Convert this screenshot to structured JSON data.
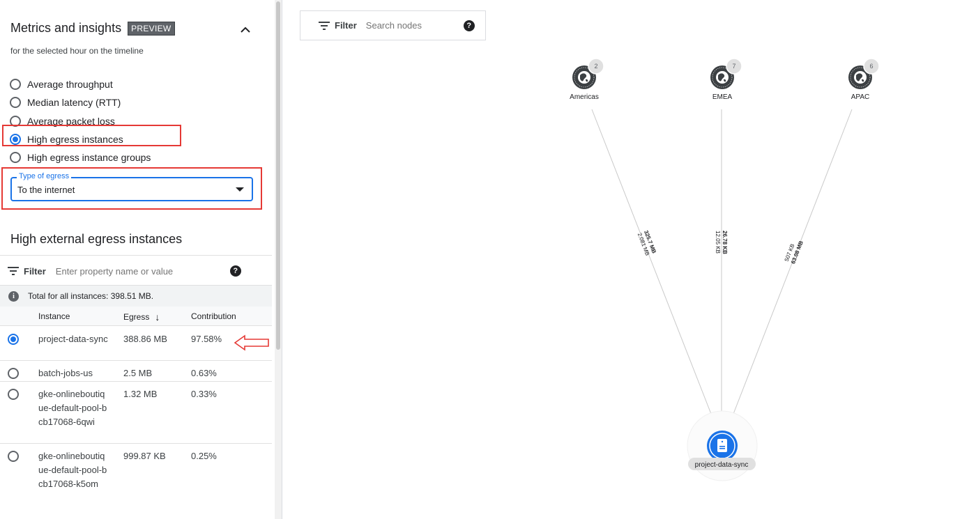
{
  "panel": {
    "title": "Metrics and insights",
    "badge": "PREVIEW",
    "subtitle": "for the selected hour on the timeline",
    "metric_options": [
      {
        "label": "Average throughput",
        "selected": false
      },
      {
        "label": "Median latency (RTT)",
        "selected": false
      },
      {
        "label": "Average packet loss",
        "selected": false
      },
      {
        "label": "High egress instances",
        "selected": true
      },
      {
        "label": "High egress instance groups",
        "selected": false
      }
    ],
    "egress_type": {
      "legend": "Type of egress",
      "value": "To the internet"
    }
  },
  "instances_section": {
    "title": "High external egress instances",
    "filter_label": "Filter",
    "filter_placeholder": "Enter property name or value",
    "help": "?",
    "info_icon": "i",
    "total_text": "Total for all instances: 398.51 MB.",
    "columns": {
      "instance": "Instance",
      "egress": "Egress",
      "contribution": "Contribution",
      "sort_icon": "↓"
    },
    "rows": [
      {
        "name": "project-data-sync",
        "egress": "388.86 MB",
        "contribution": "97.58%",
        "selected": true
      },
      {
        "name": "batch-jobs-us",
        "egress": "2.5 MB",
        "contribution": "0.63%",
        "selected": false
      },
      {
        "name": "gke-onlineboutique-default-pool-bcb17068-6qwi",
        "egress": "1.32 MB",
        "contribution": "0.33%",
        "selected": false
      },
      {
        "name": "gke-onlineboutique-default-pool-bcb17068-k5om",
        "egress": "999.87 KB",
        "contribution": "0.25%",
        "selected": false
      }
    ]
  },
  "graph": {
    "filter_label": "Filter",
    "search_placeholder": "Search nodes",
    "help": "?",
    "regions": [
      {
        "name": "Americas",
        "count": "2",
        "bold_label": "325.7 MB",
        "light_label": "2.081 MB"
      },
      {
        "name": "EMEA",
        "count": "7",
        "bold_label": "26.78 KB",
        "light_label": "12.05 KB"
      },
      {
        "name": "APAC",
        "count": "6",
        "bold_label": "63.08 MB",
        "light_label": "507 KB"
      }
    ],
    "target": {
      "name": "project-data-sync"
    }
  },
  "colors": {
    "accent": "#1a73e8",
    "highlight": "#e53935",
    "node": "#3c4043"
  }
}
